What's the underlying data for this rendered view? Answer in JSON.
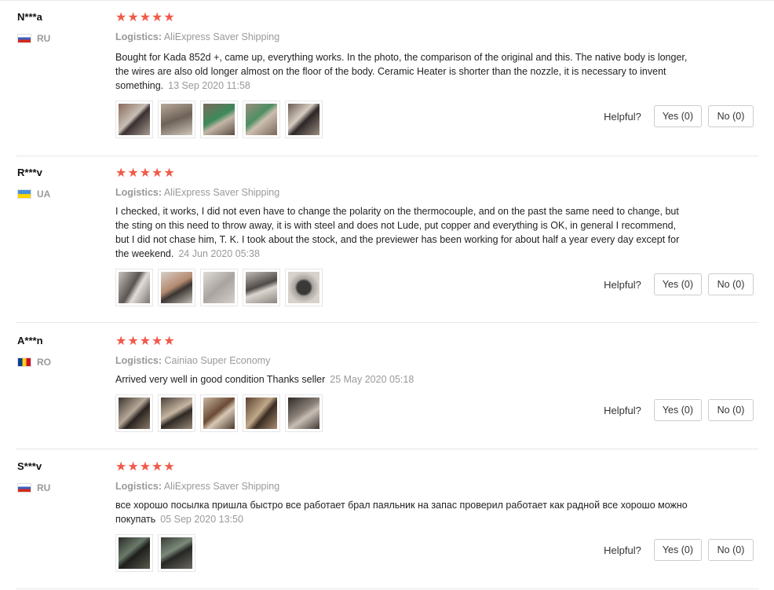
{
  "reviews": [
    {
      "user": "N***a",
      "country": "RU",
      "flag": "ru",
      "stars": "★★★★★",
      "logistics_label": "Logistics:",
      "logistics_value": "AliExpress Saver Shipping",
      "text": "Bought for Kada 852d +, came up, everything works. In the photo, the comparison of the original and this. The native body is longer, the wires are also old longer almost on the floor of the body. Ceramic Heater is shorter than the nozzle, it is necessary to invent something.",
      "date": "13 Sep 2020 11:58",
      "photos": 5,
      "helpful_label": "Helpful?",
      "yes_label": "Yes (0)",
      "no_label": "No (0)"
    },
    {
      "user": "R***v",
      "country": "UA",
      "flag": "ua",
      "stars": "★★★★★",
      "logistics_label": "Logistics:",
      "logistics_value": "AliExpress Saver Shipping",
      "text": "I checked, it works, I did not even have to change the polarity on the thermocouple, and on the past the same need to change, but the sting on this need to throw away, it is with steel and does not Lude, put copper and everything is OK, in general I recommend, but I did not chase him, T. K. I took about the stock, and the previewer has been working for about half a year every day except for the weekend.",
      "date": "24 Jun 2020 05:38",
      "photos": 5,
      "helpful_label": "Helpful?",
      "yes_label": "Yes (0)",
      "no_label": "No (0)"
    },
    {
      "user": "A***n",
      "country": "RO",
      "flag": "ro",
      "stars": "★★★★★",
      "logistics_label": "Logistics:",
      "logistics_value": "Cainiao Super Economy",
      "text": "Arrived very well in good condition Thanks seller",
      "date": "25 May 2020 05:18",
      "photos": 5,
      "helpful_label": "Helpful?",
      "yes_label": "Yes (0)",
      "no_label": "No (0)"
    },
    {
      "user": "S***v",
      "country": "RU",
      "flag": "ru",
      "stars": "★★★★★",
      "logistics_label": "Logistics:",
      "logistics_value": "AliExpress Saver Shipping",
      "text": "все хорошо посылка пришла быстро все работает брал паяльник на запас проверил работает как радной все хорошо можно покупать",
      "date": "05 Sep 2020 13:50",
      "photos": 2,
      "helpful_label": "Helpful?",
      "yes_label": "Yes (0)",
      "no_label": "No (0)"
    }
  ]
}
